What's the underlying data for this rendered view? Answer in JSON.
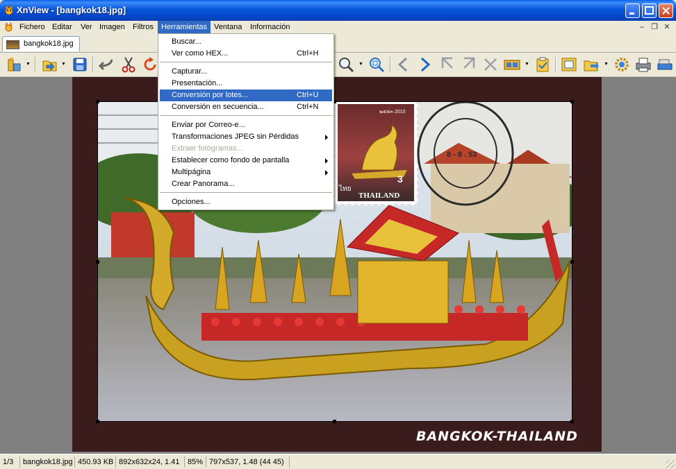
{
  "window": {
    "title": "XnView - [bangkok18.jpg]"
  },
  "menubar": {
    "items": [
      "Fichero",
      "Editar",
      "Ver",
      "Imagen",
      "Filtros",
      "Herramientas",
      "Ventana",
      "Información"
    ],
    "active": "Herramientas",
    "mdi_controls": [
      "minimize-icon",
      "restore-icon",
      "close-icon"
    ]
  },
  "tabs": [
    {
      "label": "bangkok18.jpg",
      "icon": "image-thumbnail-icon"
    }
  ],
  "toolbar": {
    "icons": [
      "browser-icon",
      "open-icon",
      "save-icon",
      "undo-icon",
      "cut-icon",
      "rotate-icon",
      "zoom-icon",
      "zoom-fit-icon",
      "previous-icon",
      "next-icon",
      "first-icon",
      "last-icon",
      "slideshow-icon",
      "filmstrip-icon",
      "clipboard-icon",
      "fullscreen-icon",
      "open-folder-icon",
      "settings-icon",
      "print-icon",
      "scanner-icon"
    ]
  },
  "dropdown": {
    "items": [
      {
        "label": "Buscar...",
        "shortcut": ""
      },
      {
        "label": "Ver como HEX...",
        "shortcut": "Ctrl+H"
      },
      {
        "label": "Capturar...",
        "shortcut": ""
      },
      {
        "label": "Presentación...",
        "shortcut": ""
      },
      {
        "label": "Conversión por lotes...",
        "shortcut": "Ctrl+U",
        "highlighted": true
      },
      {
        "label": "Conversión en secuencia...",
        "shortcut": "Ctrl+N"
      },
      {
        "label": "Enviar por Correo-e...",
        "shortcut": ""
      },
      {
        "label": "Transformaciones JPEG sin Pérdidas",
        "shortcut": "",
        "submenu": true
      },
      {
        "label": "Extraer fotogramas...",
        "shortcut": "",
        "disabled": true
      },
      {
        "label": "Establecer como fondo de pantalla",
        "shortcut": "",
        "submenu": true
      },
      {
        "label": "Multipágina",
        "shortcut": "",
        "submenu": true
      },
      {
        "label": "Crear Panorama...",
        "shortcut": ""
      },
      {
        "label": "Opciones...",
        "shortcut": ""
      }
    ]
  },
  "image": {
    "caption": "BANGKOK-THAILAND",
    "stamp_text": "THAILAND",
    "stamp_small": "ไทย",
    "stamp_year": "๒๕๕๓ 2010",
    "stamp_value": "3"
  },
  "statusbar": {
    "index": "1/3",
    "filename": "bangkok18.jpg",
    "filesize": "450.93 KB",
    "dimensions": "892x632x24, 1.41",
    "zoom": "85%",
    "cursor": "797x537, 1.48 (44 45)"
  },
  "colors": {
    "titlebar": "#0855DD",
    "menu_highlight": "#316AC5",
    "chrome": "#ECE9D8",
    "viewer_bg": "#808080"
  }
}
